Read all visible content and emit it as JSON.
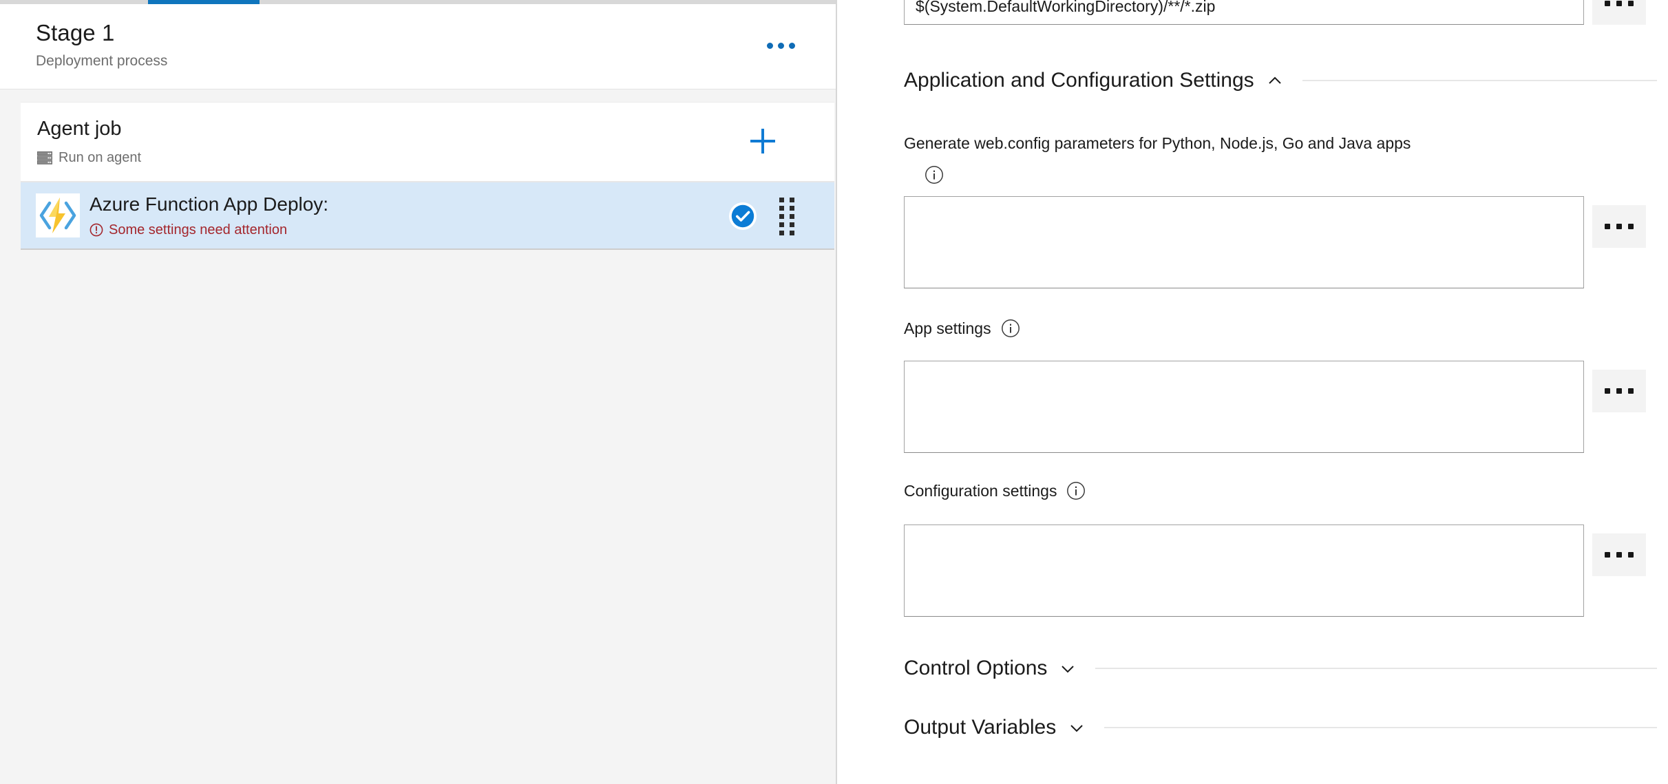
{
  "left_panel": {
    "tab_indicator": {
      "name": "tasks-tab-active-indicator",
      "color": "#0f75bd"
    },
    "stage": {
      "title": "Stage 1",
      "subtitle": "Deployment process",
      "more_menu_label": "...",
      "more_menu_icon": "ellipsis-horizontal-icon"
    },
    "job": {
      "name": "Agent job",
      "sub_label": "Run on agent",
      "sub_icon": "server-rack-icon",
      "add_button_icon": "plus-icon",
      "add_button_label": "+"
    },
    "task": {
      "icon": "azure-function-app-icon",
      "title": "Azure Function App Deploy:",
      "warning_icon": "warning-circle-icon",
      "warning_text": "Some settings need attention",
      "warning_color": "#a4262c",
      "enabled_icon": "check-circle-filled-icon",
      "enabled_color": "#0078d4",
      "drag_handle_icon": "drag-dots-icon",
      "selected_background": "#d7e8f8"
    }
  },
  "right_panel": {
    "package_field": {
      "value": "$(System.DefaultWorkingDirectory)/**/*.zip",
      "placeholder": "",
      "browse_button_label": "...",
      "browse_button_icon": "ellipsis-horizontal-icon"
    },
    "sections": [
      {
        "name": "application-and-configuration-settings",
        "label": "Application and Configuration Settings",
        "expanded": true,
        "chevron_icon": "chevron-up-icon"
      },
      {
        "name": "control-options",
        "label": "Control Options",
        "expanded": false,
        "chevron_icon": "chevron-down-icon"
      },
      {
        "name": "output-variables",
        "label": "Output Variables",
        "expanded": false,
        "chevron_icon": "chevron-down-icon"
      }
    ],
    "fields": [
      {
        "name": "generate-web-config-parameters",
        "label": "Generate web.config parameters for Python, Node.js, Go and Java apps",
        "info_icon": "info-circle-icon",
        "value": "",
        "placeholder": "",
        "browse_button_label": "...",
        "browse_button_icon": "ellipsis-horizontal-icon"
      },
      {
        "name": "app-settings",
        "label": "App settings",
        "info_icon": "info-circle-icon",
        "value": "",
        "placeholder": "",
        "browse_button_label": "...",
        "browse_button_icon": "ellipsis-horizontal-icon"
      },
      {
        "name": "configuration-settings",
        "label": "Configuration settings",
        "info_icon": "info-circle-icon",
        "value": "",
        "placeholder": "",
        "browse_button_label": "...",
        "browse_button_icon": "ellipsis-horizontal-icon"
      }
    ]
  }
}
